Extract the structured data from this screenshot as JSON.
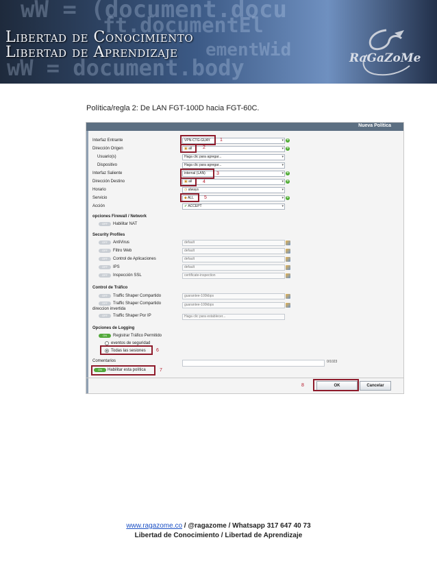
{
  "banner": {
    "brand_line1": "Libertad de Conocimiento",
    "brand_line2": "Libertad de Aprendizaje",
    "logo_text": "RaGaZoMe",
    "code_lines": [
      "wW = (document.docu",
      "ft.documentEl",
      "wW = document.body",
      "ementWid"
    ]
  },
  "caption": "Política/regla 2:  De LAN FGT-100D hacia FGT-60C.",
  "dialog": {
    "title": "Nueva Política",
    "fields": {
      "interfaz_entrante": {
        "label": "Interfaz Entrante",
        "value": "VPN-CTG-GUAY"
      },
      "direccion_origen": {
        "label": "Dirección Origen",
        "value": "all"
      },
      "usuarios": {
        "label": "Usuario(s)",
        "value": "Haga clic para agregar..."
      },
      "dispositivo": {
        "label": "Dispositivo",
        "value": "Haga clic para agregar..."
      },
      "interfaz_saliente": {
        "label": "Interfaz Saliente",
        "value": "internal (LAN)"
      },
      "direccion_destino": {
        "label": "Dirección Destino",
        "value": "all"
      },
      "horario": {
        "label": "Horario",
        "value": "always"
      },
      "servicio": {
        "label": "Servicio",
        "value": "ALL"
      },
      "accion": {
        "label": "Acción",
        "value": "ACCEPT"
      }
    },
    "firewall_network": {
      "title": "opciones Firewall / Network",
      "nat_label": "Habilitar NAT"
    },
    "security_profiles": {
      "title": "Security Profiles",
      "items": [
        {
          "label": "AntiVirus",
          "value": "default"
        },
        {
          "label": "Filtro Web",
          "value": "default"
        },
        {
          "label": "Control de Aplicaciones",
          "value": "default"
        },
        {
          "label": "IPS",
          "value": "default"
        },
        {
          "label": "Inspección SSL",
          "value": "certificate-inspection"
        }
      ]
    },
    "traffic_control": {
      "title": "Control de Tráfico",
      "shared_label": "Traffic Shaper Compartido",
      "shared_value": "guarantee-100kbps",
      "reverse_label_line1": "Traffic Shaper Compartido",
      "reverse_label_line2": "direccion invertida",
      "reverse_value": "guarantee-100kbps",
      "per_ip_label": "Traffic Shaper Por IP",
      "per_ip_value": "Haga clic para establecer..."
    },
    "logging": {
      "title": "Opciones de Logging",
      "log_allowed_label": "Registrar Tráfico Permitido",
      "security_events_label": "eventos de seguridad",
      "all_sessions_label": "Todas las sesiones"
    },
    "comments": {
      "label": "Comentarios",
      "counter": "0/1023"
    },
    "enable_policy_label": "Habilitar esta política",
    "ok_label": "OK",
    "cancel_label": "Cancelar",
    "toggle_off": "OFF",
    "toggle_on": "ON",
    "dropdown_arrow": "▾",
    "add_symbol": "+"
  },
  "annotations": [
    "1",
    "2",
    "3",
    "4",
    "5",
    "6",
    "7",
    "8"
  ],
  "footer": {
    "link": "www.ragazome.co",
    "contact": " / @ragazome / Whatsapp 317 647 40 73",
    "tagline": "Libertad de Conocimiento / Libertad de Aprendizaje"
  },
  "colors": {
    "annotation": "#8e1a2a",
    "toggle_on": "#52a83a",
    "link": "#1a4fc4"
  }
}
